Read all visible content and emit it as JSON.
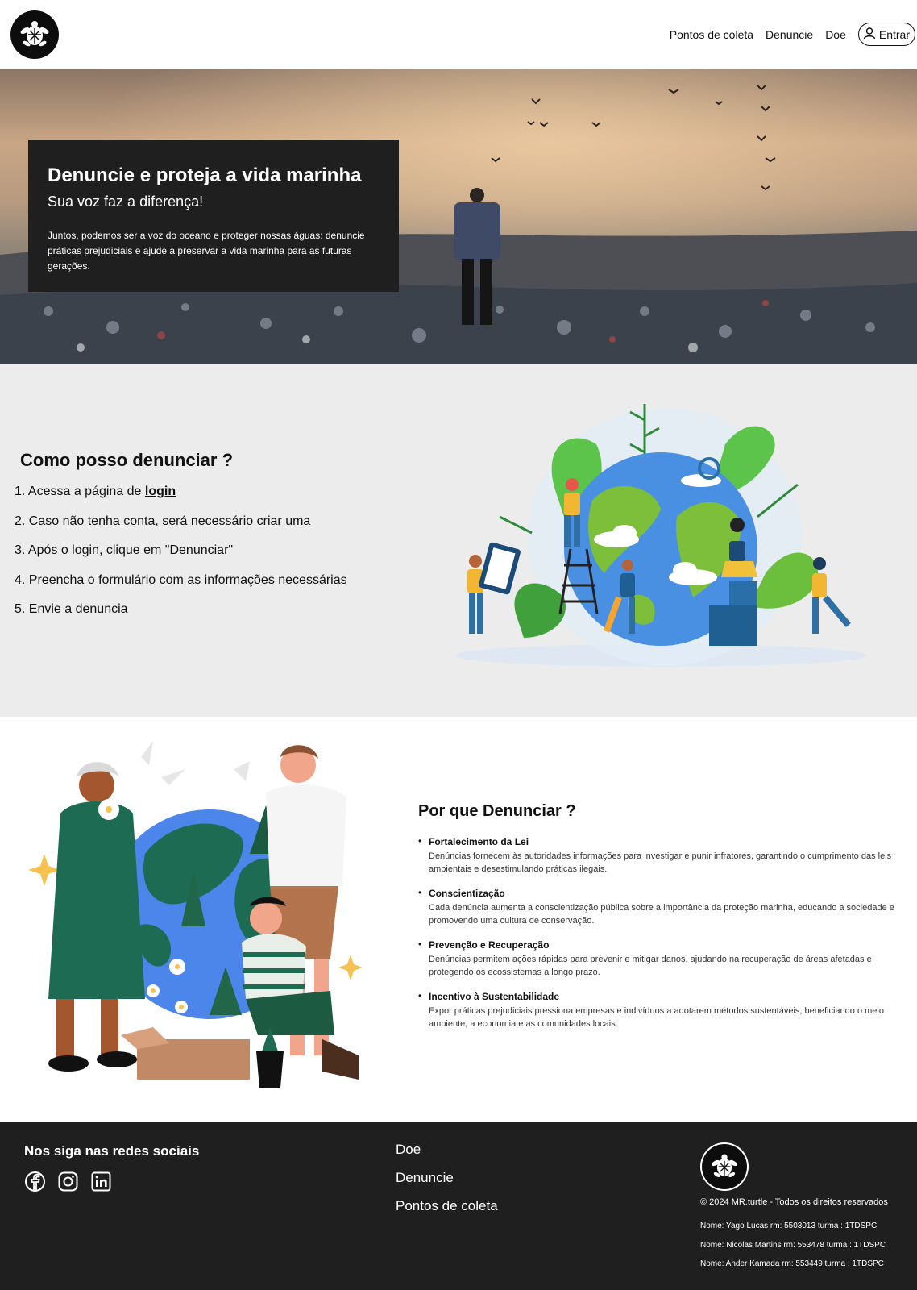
{
  "header": {
    "nav": [
      "Pontos de coleta",
      "Denuncie",
      "Doe"
    ],
    "login_label": "Entrar"
  },
  "hero": {
    "title": "Denuncie e proteja a vida marinha",
    "subtitle": "Sua voz faz a diferença!",
    "text": "Juntos, podemos ser a voz do oceano e proteger nossas águas: denuncie práticas prejudiciais e ajude a preservar a vida marinha para as futuras gerações."
  },
  "how": {
    "title": "Como posso denunciar ?",
    "steps": [
      {
        "prefix": "1. Acessa a página de ",
        "link": "login"
      },
      {
        "text": "2. Caso não tenha conta, será necessário criar uma"
      },
      {
        "text": "3. Após o login, clique em \"Denunciar\""
      },
      {
        "text": "4. Preencha o formulário com as informações necessárias"
      },
      {
        "text": "5. Envie a denuncia"
      }
    ]
  },
  "why": {
    "title": "Por que Denunciar ?",
    "items": [
      {
        "title": "Fortalecimento da Lei",
        "text": "Denúncias fornecem às autoridades informações para investigar e punir infratores, garantindo o cumprimento das leis ambientais e desestimulando práticas ilegais."
      },
      {
        "title": "Conscientização",
        "text": "Cada denúncia aumenta a conscientização pública sobre a importância da proteção marinha, educando a sociedade e promovendo uma cultura de conservação."
      },
      {
        "title": "Prevenção e Recuperação",
        "text": "Denúncias permitem ações rápidas para prevenir e mitigar danos, ajudando na recuperação de áreas afetadas e protegendo os ecossistemas a longo prazo."
      },
      {
        "title": "Incentivo à Sustentabilidade",
        "text": "Expor práticas prejudiciais pressiona empresas e indivíduos a adotarem métodos sustentáveis, beneficiando o meio ambiente, a economia e as comunidades locais."
      }
    ]
  },
  "footer": {
    "social_title": "Nos siga nas redes sociais",
    "social_icons": [
      "facebook-icon",
      "instagram-icon",
      "linkedin-icon"
    ],
    "links": [
      "Doe",
      "Denuncie",
      "Pontos de coleta"
    ],
    "copyright": "© 2024 MR.turtle - Todos os direitos reservados",
    "names": [
      "Nome: Yago Lucas rm: 5503013 turma : 1TDSPC",
      "Nome: Nicolas Martins rm: 553478 turma : 1TDSPC",
      "Nome: Ander Kamada rm: 553449 turma : 1TDSPC"
    ]
  },
  "colors": {
    "dark": "#1f1f1f",
    "section_gray": "#ececec"
  }
}
